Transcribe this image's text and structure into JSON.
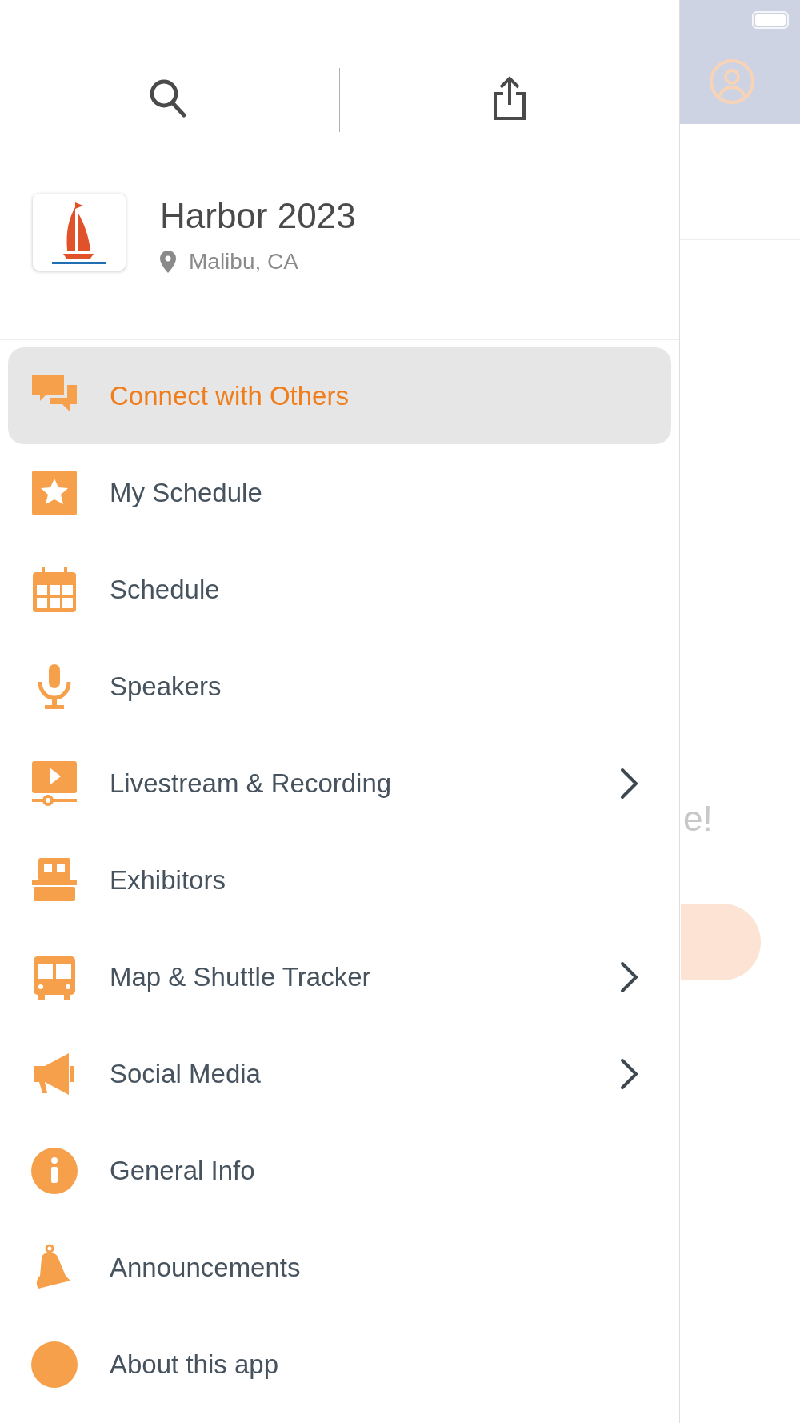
{
  "event": {
    "title": "Harbor 2023",
    "location": "Malibu, CA"
  },
  "menu": [
    {
      "label": "Connect with Others",
      "kind": "chat",
      "selected": true,
      "submenu": false
    },
    {
      "label": "My Schedule",
      "kind": "star",
      "selected": false,
      "submenu": false
    },
    {
      "label": "Schedule",
      "kind": "calendar",
      "selected": false,
      "submenu": false
    },
    {
      "label": "Speakers",
      "kind": "mic",
      "selected": false,
      "submenu": false
    },
    {
      "label": "Livestream & Recording",
      "kind": "video",
      "selected": false,
      "submenu": true
    },
    {
      "label": "Exhibitors",
      "kind": "booth",
      "selected": false,
      "submenu": false
    },
    {
      "label": "Map & Shuttle Tracker",
      "kind": "bus",
      "selected": false,
      "submenu": true
    },
    {
      "label": "Social Media",
      "kind": "megaphone",
      "selected": false,
      "submenu": true
    },
    {
      "label": "General Info",
      "kind": "info",
      "selected": false,
      "submenu": false
    },
    {
      "label": "Announcements",
      "kind": "bell",
      "selected": false,
      "submenu": false
    },
    {
      "label": "About this app",
      "kind": "dot",
      "selected": false,
      "submenu": false
    }
  ],
  "background": {
    "text": "e!"
  }
}
